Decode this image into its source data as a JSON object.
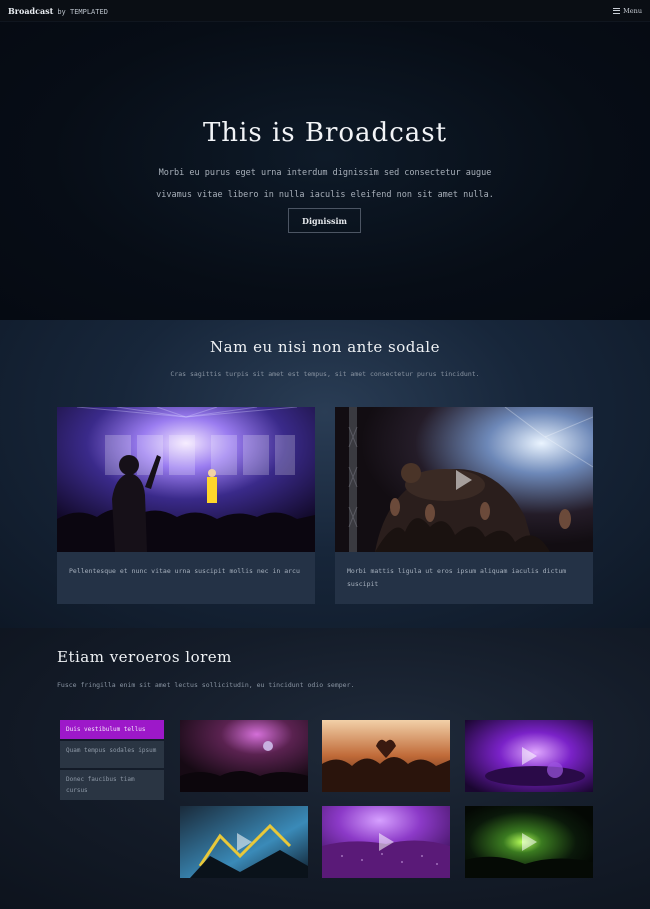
{
  "header": {
    "brand": "Broadcast",
    "by": "by TEMPLATED",
    "menu_label": "Menu"
  },
  "hero": {
    "title": "This is Broadcast",
    "text_line1": "Morbi eu purus eget urna interdum dignissim sed consectetur augue",
    "text_line2": "vivamus vitae libero in nulla iaculis eleifend non sit amet nulla.",
    "button_label": "Dignissim"
  },
  "featured": {
    "title": "Nam eu nisi non ante sodale",
    "subtitle": "Cras sagittis turpis sit amet est tempus, sit amet consectetur purus tincidunt.",
    "cards": [
      {
        "text": "Pellentesque et nunc vitae urna suscipit mollis nec in arcu"
      },
      {
        "text": "Morbi mattis ligula ut eros ipsum aliquam iaculis dictum suscipit"
      }
    ]
  },
  "gallery": {
    "title": "Etiam veroeros lorem",
    "subtitle": "Fusce fringilla enim sit amet lectus sollicitudin, eu tincidunt odio semper.",
    "tabs": [
      {
        "label": "Duis vestibulum tellus"
      },
      {
        "label": "Quam tempus sodales ipsum"
      },
      {
        "label": "Donec faucibus tiam cursus"
      }
    ]
  },
  "colors": {
    "accent": "#9d18c9",
    "card_bg": "#243246",
    "hero_bg": "#070d16"
  }
}
